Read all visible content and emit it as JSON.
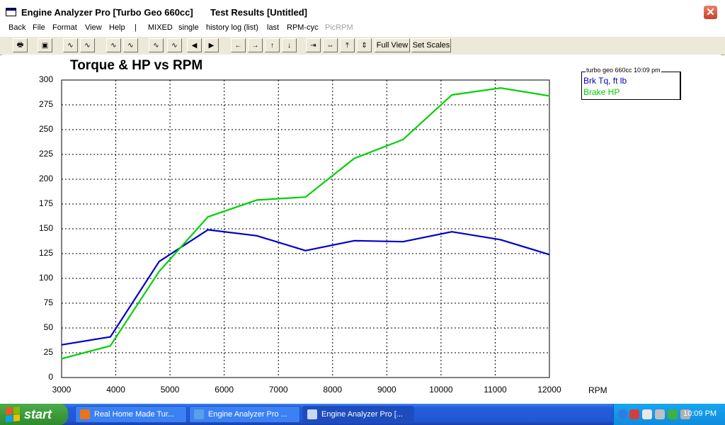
{
  "window": {
    "app_title": "Engine Analyzer Pro [Turbo Geo 660cc]",
    "doc_title": "Test Results [Untitled]",
    "close_glyph": "✕",
    "icon": "window-app-icon"
  },
  "menu": {
    "items": [
      {
        "label": "Back",
        "enabled": true
      },
      {
        "label": "File",
        "enabled": true
      },
      {
        "label": "Format",
        "enabled": true
      },
      {
        "label": "View",
        "enabled": true
      },
      {
        "label": "Help",
        "enabled": true
      },
      {
        "label": "|",
        "enabled": true
      },
      {
        "label": "MIXED",
        "enabled": true
      },
      {
        "label": "single",
        "enabled": true
      },
      {
        "label": "history log (list)",
        "enabled": true
      },
      {
        "label": "last",
        "enabled": true
      },
      {
        "label": "RPM-cyc",
        "enabled": true
      },
      {
        "label": "PicRPM",
        "enabled": false
      }
    ]
  },
  "toolbar": {
    "full_view_label": "Full View",
    "set_scales_label": "Set Scales",
    "buttons": [
      {
        "icon": "printer-icon",
        "glyph": "🖶"
      },
      {
        "icon": "monitor-icon",
        "glyph": "▣"
      },
      {
        "icon": "graph-curves-icon",
        "glyph": "∿"
      },
      {
        "icon": "graph-curves-alt-icon",
        "glyph": "∿"
      },
      {
        "icon": "graph-overlay-icon",
        "glyph": "∿"
      },
      {
        "icon": "graph-overlay-alt-icon",
        "glyph": "∿"
      },
      {
        "icon": "graph-compare-icon",
        "glyph": "∿"
      },
      {
        "icon": "graph-compare-alt-icon",
        "glyph": "∿"
      },
      {
        "icon": "prev-test-icon",
        "glyph": "◀"
      },
      {
        "icon": "next-test-icon",
        "glyph": "▶"
      },
      {
        "icon": "arrow-left-icon",
        "glyph": "←"
      },
      {
        "icon": "arrow-right-icon",
        "glyph": "→"
      },
      {
        "icon": "arrow-up-icon",
        "glyph": "↑"
      },
      {
        "icon": "arrow-down-icon",
        "glyph": "↓"
      },
      {
        "icon": "compress-horizontal-icon",
        "glyph": "⇥"
      },
      {
        "icon": "expand-horizontal-icon",
        "glyph": "⇔"
      },
      {
        "icon": "compress-vertical-icon",
        "glyph": "⤒"
      },
      {
        "icon": "expand-vertical-icon",
        "glyph": "⇕"
      }
    ]
  },
  "chart_data": {
    "type": "line",
    "title": "Torque & HP vs RPM",
    "xlabel": "RPM",
    "ylabel": "",
    "xlim": [
      3000,
      12000
    ],
    "ylim": [
      0,
      300
    ],
    "xticks": [
      3000,
      4000,
      5000,
      6000,
      7000,
      8000,
      9000,
      10000,
      11000,
      12000
    ],
    "yticks": [
      0,
      25,
      50,
      75,
      100,
      125,
      150,
      175,
      200,
      225,
      250,
      275,
      300
    ],
    "grid": true,
    "grid_style": "dotted",
    "legend_placement": "top-right",
    "legend_title": "turbo geo 660cc 10:09 pm",
    "series": [
      {
        "name": "Brk Tq, ft lb",
        "color": "#0000c8",
        "x": [
          3000,
          3900,
          4800,
          5700,
          6600,
          7500,
          8400,
          9300,
          10200,
          11100,
          12000
        ],
        "values": [
          33,
          41,
          117,
          149,
          143,
          128,
          138,
          137,
          147,
          139,
          124
        ]
      },
      {
        "name": "Brake HP",
        "color": "#00d000",
        "x": [
          3000,
          3900,
          4800,
          5700,
          6600,
          7500,
          8400,
          9300,
          10200,
          11100,
          12000
        ],
        "values": [
          19,
          32,
          107,
          162,
          179,
          182,
          221,
          240,
          285,
          292,
          284
        ]
      }
    ]
  },
  "taskbar": {
    "start_label": "start",
    "tasks": [
      {
        "label": "Real Home Made Tur...",
        "icon": "firefox-icon",
        "active": false
      },
      {
        "label": "Engine Analyzer Pro ...",
        "icon": "engine-analyzer-icon",
        "active": false
      },
      {
        "label": "Engine Analyzer Pro [...",
        "icon": "engine-analyzer-window-icon",
        "active": true
      }
    ],
    "clock": "10:09 PM",
    "tray_icons": [
      "tray-expand-icon",
      "tray-app-icon",
      "network-icon",
      "volume-icon",
      "security-icon",
      "speaker-icon"
    ]
  }
}
